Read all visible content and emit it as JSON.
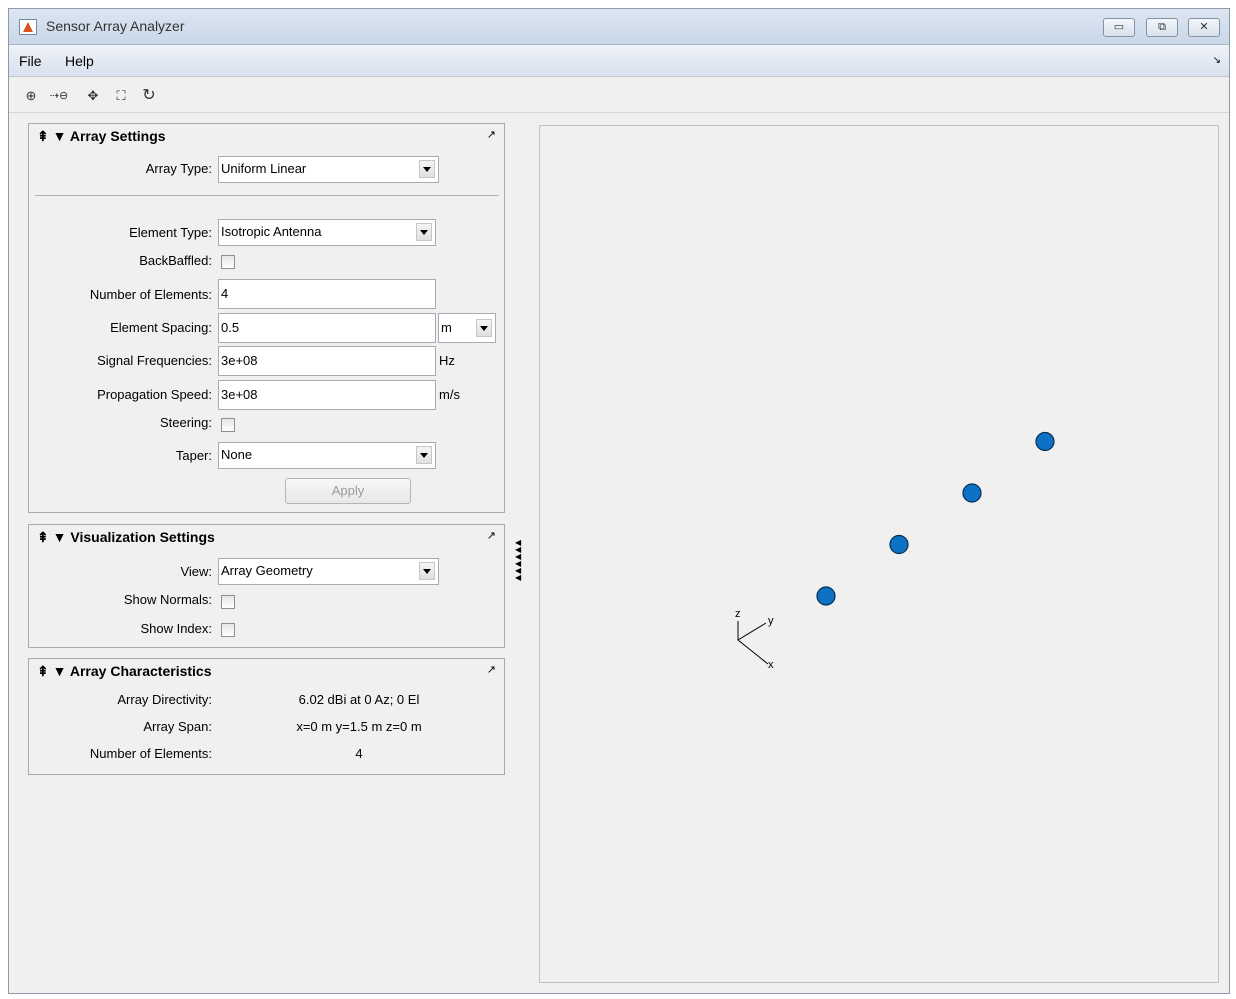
{
  "window": {
    "title": "Sensor Array Analyzer",
    "minimize_label": "▭",
    "restore_label": "⧉",
    "close_label": "✕"
  },
  "menu": {
    "items": [
      "File",
      "Help"
    ]
  },
  "toolbar": {
    "icons": [
      "zoom-in-icon",
      "zoom-out-icon",
      "pan-icon",
      "fit-icon",
      "rotate-icon"
    ]
  },
  "array_settings": {
    "header": "Array Settings",
    "array_type_label": "Array Type:",
    "array_type_value": "Uniform Linear",
    "element_type_label": "Element Type:",
    "element_type_value": "Isotropic Antenna",
    "backbaffled_label": "BackBaffled:",
    "num_elements_label": "Number of Elements:",
    "num_elements_value": "4",
    "element_spacing_label": "Element Spacing:",
    "element_spacing_value": "0.5",
    "element_spacing_unit": "m",
    "signal_freq_label": "Signal Frequencies:",
    "signal_freq_value": "3e+08",
    "signal_freq_unit": "Hz",
    "prop_speed_label": "Propagation Speed:",
    "prop_speed_value": "3e+08",
    "prop_speed_unit": "m/s",
    "steering_label": "Steering:",
    "taper_label": "Taper:",
    "taper_value": "None",
    "apply_label": "Apply"
  },
  "visualization_settings": {
    "header": "Visualization Settings",
    "view_label": "View:",
    "view_value": "Array Geometry",
    "show_normals_label": "Show Normals:",
    "show_index_label": "Show Index:"
  },
  "array_characteristics": {
    "header": "Array Characteristics",
    "directivity_label": "Array Directivity:",
    "directivity_value": "6.02 dBi at 0 Az; 0 El",
    "span_label": "Array Span:",
    "span_value": "x=0 m y=1.5 m z=0 m",
    "num_elements_label": "Number of Elements:",
    "num_elements_value": "4"
  },
  "plot": {
    "axis_labels": {
      "z": "z",
      "y": "y",
      "x": "x"
    },
    "element_color": "#0d72c6",
    "elements": [
      {
        "index": 1,
        "y": 0
      },
      {
        "index": 2,
        "y": 0.5
      },
      {
        "index": 3,
        "y": 1.0
      },
      {
        "index": 4,
        "y": 1.5
      }
    ]
  }
}
